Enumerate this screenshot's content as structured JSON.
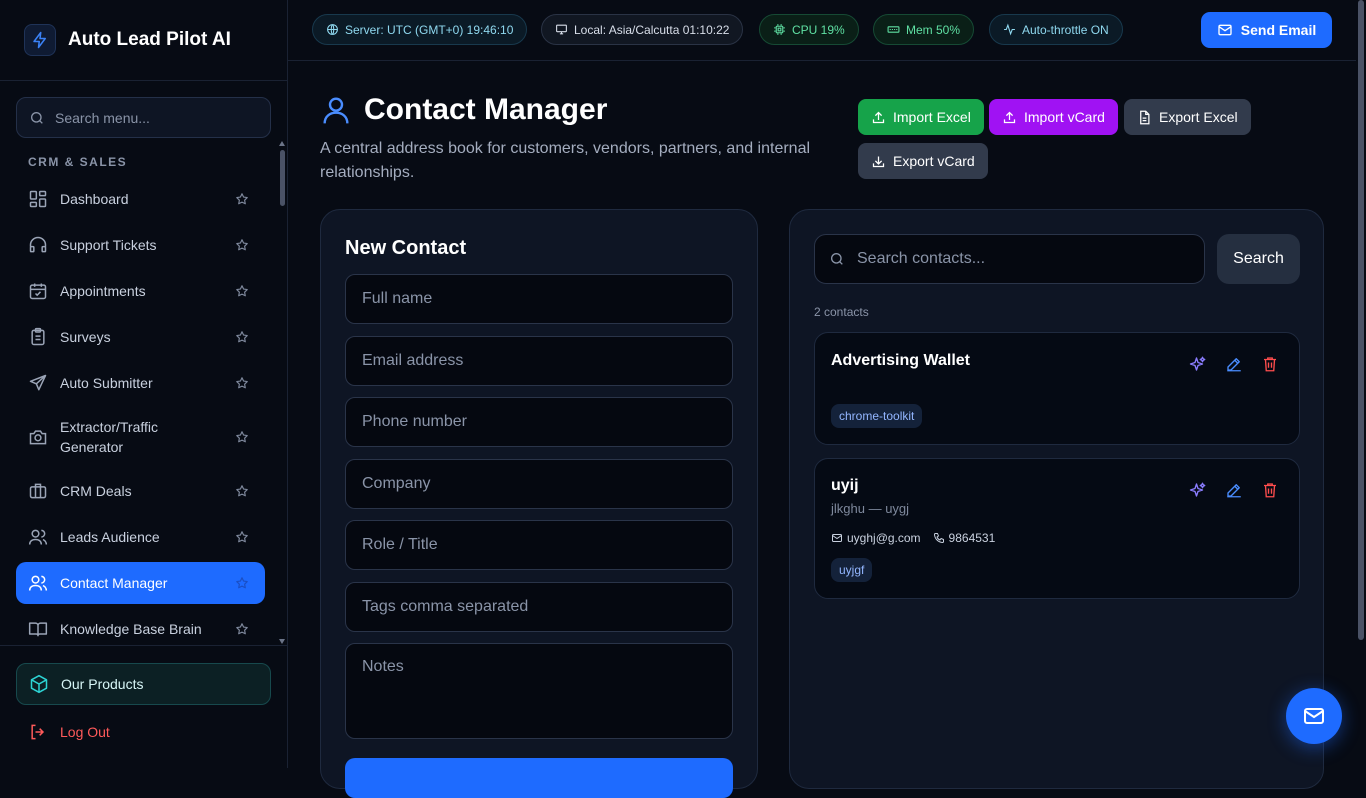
{
  "app": {
    "title": "Auto Lead Pilot AI"
  },
  "sidebar": {
    "search_placeholder": "Search menu...",
    "section_label": "CRM & SALES",
    "items": [
      {
        "label": "Dashboard",
        "icon": "dashboard-icon"
      },
      {
        "label": "Support Tickets",
        "icon": "headset-icon"
      },
      {
        "label": "Appointments",
        "icon": "calendar-check-icon"
      },
      {
        "label": "Surveys",
        "icon": "clipboard-icon"
      },
      {
        "label": "Auto Submitter",
        "icon": "send-icon"
      },
      {
        "label": "Extractor/Traffic Generator",
        "icon": "camera-icon"
      },
      {
        "label": "CRM Deals",
        "icon": "briefcase-icon"
      },
      {
        "label": "Leads Audience",
        "icon": "users-icon"
      },
      {
        "label": "Contact Manager",
        "icon": "users-icon",
        "active": true
      },
      {
        "label": "Knowledge Base Brain",
        "icon": "book-icon"
      }
    ],
    "our_products": "Our Products",
    "logout": "Log Out"
  },
  "topbar": {
    "server": "Server: UTC (GMT+0) 19:46:10",
    "local": "Local: Asia/Calcutta 01:10:22",
    "cpu": "CPU 19%",
    "mem": "Mem 50%",
    "throttle": "Auto-throttle ON",
    "send_email": "Send Email"
  },
  "page": {
    "title": "Contact Manager",
    "subtitle": "A central address book for customers, vendors, partners, and internal relationships.",
    "actions": {
      "import_excel": "Import Excel",
      "import_vcard": "Import vCard",
      "export_excel": "Export Excel",
      "export_vcard": "Export vCard"
    }
  },
  "new_contact": {
    "title": "New Contact",
    "placeholders": {
      "full_name": "Full name",
      "email": "Email address",
      "phone": "Phone number",
      "company": "Company",
      "role": "Role / Title",
      "tags": "Tags comma separated",
      "notes": "Notes"
    }
  },
  "contacts": {
    "search_placeholder": "Search contacts...",
    "search_button": "Search",
    "count": "2 contacts",
    "items": [
      {
        "name": "Advertising Wallet",
        "tag": "chrome-toolkit"
      },
      {
        "name": "uyij",
        "sub": "jlkghu — uygj",
        "email": "uyghj@g.com",
        "phone": "9864531",
        "tag": "uyjgf"
      }
    ]
  },
  "colors": {
    "accent": "#1e6bff",
    "import_excel": "#16a34a",
    "import_vcard": "#a012f3",
    "danger": "#ff5a5a"
  }
}
